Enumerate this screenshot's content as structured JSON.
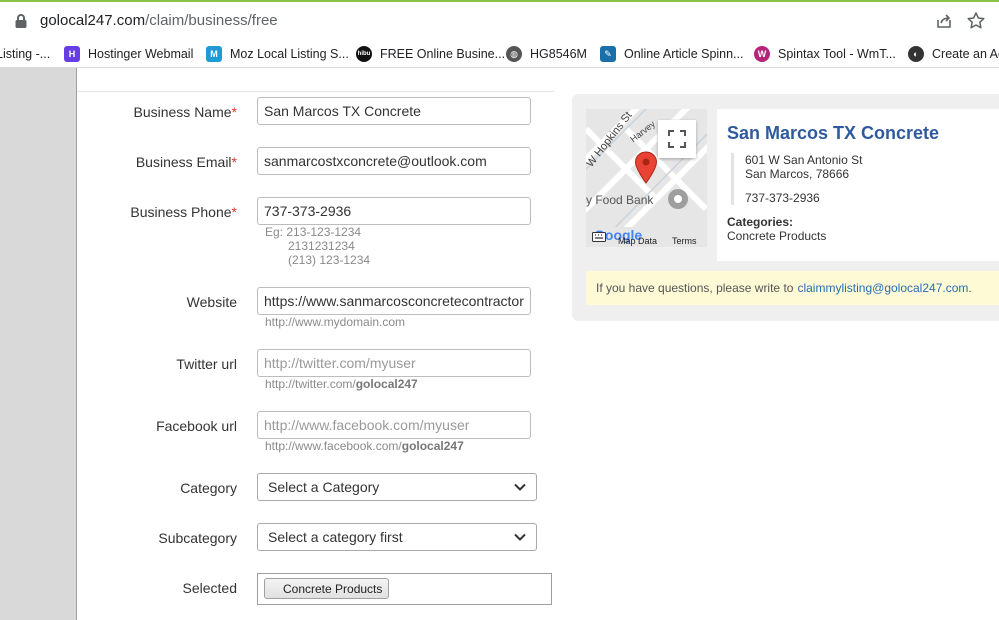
{
  "browser": {
    "url_domain": "golocal247.com",
    "url_path": "/claim/business/free",
    "bookmarks": [
      {
        "label": "Listing -...",
        "icon": "generic-icon",
        "color": "#ffffff"
      },
      {
        "label": "Hostinger Webmail",
        "icon": "hostinger-icon",
        "color": "#673de6"
      },
      {
        "label": "Moz Local Listing S...",
        "icon": "moz-icon",
        "color": "#1f9ad6"
      },
      {
        "label": "FREE Online Busine...",
        "icon": "hibu-icon",
        "color": "#111111"
      },
      {
        "label": "HG8546M",
        "icon": "globe-icon",
        "color": "#555555"
      },
      {
        "label": "Online Article Spinn...",
        "icon": "spinner-icon",
        "color": "#1b6fa8"
      },
      {
        "label": "Spintax Tool - WmT...",
        "icon": "spintax-icon",
        "color": "#b5247a"
      },
      {
        "label": "Create an Ac",
        "icon": "create-icon",
        "color": "#333333"
      }
    ]
  },
  "form": {
    "business_name": {
      "label": "Business Name",
      "required": "*",
      "value": "San Marcos TX Concrete"
    },
    "business_email": {
      "label": "Business Email",
      "required": "*",
      "value": "sanmarcostxconcrete@outlook.com"
    },
    "business_phone": {
      "label": "Business Phone",
      "required": "*",
      "value": "737-373-2936",
      "hint_1": "Eg: 213-123-1234",
      "hint_2": "2131231234",
      "hint_3": "(213) 123-1234"
    },
    "website": {
      "label": "Website",
      "value": "https://www.sanmarcosconcretecontractor",
      "hint": "http://www.mydomain.com"
    },
    "twitter": {
      "label": "Twitter url",
      "placeholder": "http://twitter.com/myuser",
      "hint_prefix": "http://twitter.com/",
      "hint_bold": "golocal247"
    },
    "facebook": {
      "label": "Facebook url",
      "placeholder": "http://www.facebook.com/myuser",
      "hint_prefix": "http://www.facebook.com/",
      "hint_bold": "golocal247"
    },
    "category": {
      "label": "Category",
      "value": "Select a Category"
    },
    "subcategory": {
      "label": "Subcategory",
      "value": "Select a category first"
    },
    "selected": {
      "label": "Selected",
      "tag": "Concrete Products"
    }
  },
  "card": {
    "map": {
      "street_1": "W Hopkins St",
      "street_2": "Harvey",
      "poi": "y Food Bank",
      "google": "Google",
      "map_data": "Map Data",
      "terms": "Terms"
    },
    "title": "San Marcos TX Concrete",
    "address_1": "601 W San Antonio St",
    "address_2": "San Marcos, 78666",
    "phone": "737-373-2936",
    "categories_heading": "Categories:",
    "categories_value": "Concrete Products",
    "notice_text": "If you have questions, please write to",
    "notice_email": "claimmylisting@golocal247.com",
    "notice_end": "."
  }
}
